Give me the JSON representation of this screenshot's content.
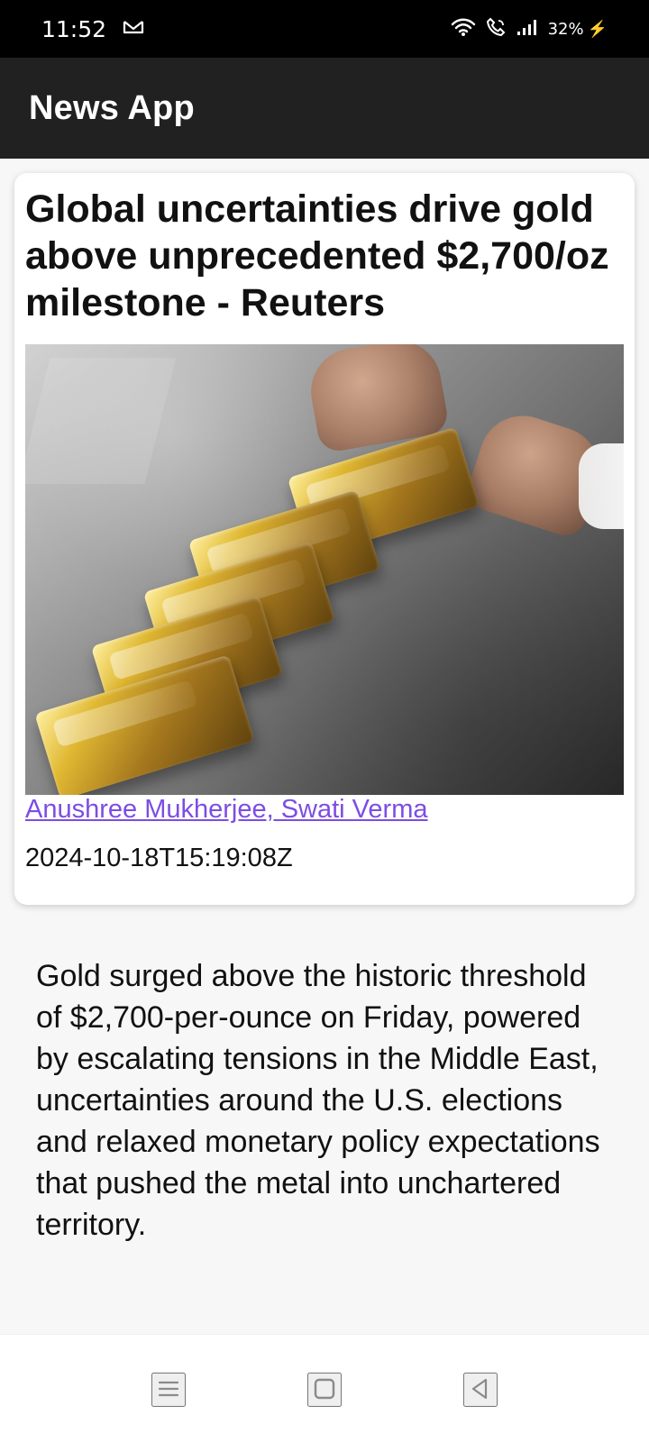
{
  "status_bar": {
    "time": "11:52",
    "battery": "32%",
    "icons": [
      "gmail-icon",
      "wifi-icon",
      "wifi-calling-icon",
      "signal-icon",
      "charging-icon"
    ]
  },
  "app_bar": {
    "title": "News App"
  },
  "article": {
    "headline": "Global uncertainties drive gold above unprecedented $2,700/oz milestone - Reuters",
    "authors": "Anushree Mukherjee, Swati Verma",
    "published_at": "2024-10-18T15:19:08Z",
    "body": "Gold surged above the historic threshold of $2,700-per-ounce on Friday, powered by escalating tensions in the Middle East, uncertainties around the U.S. elections and relaxed monetary policy expectations that pushed the metal into unchartered territory."
  },
  "navigation": {
    "icons": [
      "menu-icon",
      "home-icon",
      "back-icon"
    ]
  },
  "colors": {
    "status_bar": "#000000",
    "app_bar": "#212121",
    "author_link": "#7c4de4",
    "background": "#f7f7f8"
  }
}
